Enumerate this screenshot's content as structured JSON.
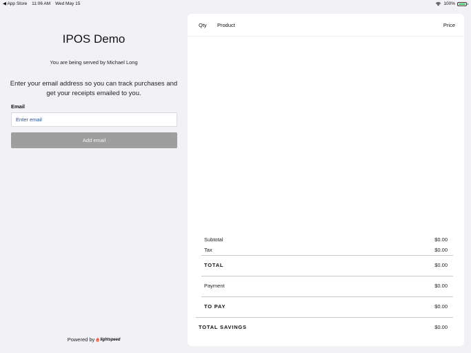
{
  "status_bar": {
    "back_app": "◀ App Store",
    "time": "11:06 AM",
    "date": "Wed May 15",
    "battery": "100%",
    "battery_level": 1.0
  },
  "left": {
    "store_title": "IPOS Demo",
    "served_by": "You are being served by Michael Long",
    "email_prompt": "Enter your email address so you can track purchases and get your receipts emailed to you.",
    "email_label": "Email",
    "email_placeholder": "Enter email",
    "email_value": "",
    "add_email_label": "Add email",
    "powered_by": "Powered by",
    "brand_name": "lightspeed"
  },
  "receipt": {
    "columns": {
      "qty": "Qty",
      "product": "Product",
      "price": "Price"
    },
    "items": [],
    "subtotal": {
      "label": "Subtotal",
      "value": "$0.00"
    },
    "tax": {
      "label": "Tax",
      "value": "$0.00"
    },
    "total": {
      "label": "TOTAL",
      "value": "$0.00"
    },
    "payment": {
      "label": "Payment",
      "value": "$0.00"
    },
    "to_pay": {
      "label": "TO PAY",
      "value": "$0.00"
    },
    "total_savings": {
      "label": "TOTAL SAVINGS",
      "value": "$0.00"
    }
  },
  "colors": {
    "background": "#f2f1f5",
    "panel": "#ffffff",
    "button_disabled": "#9e9e9e",
    "brand_red": "#e8452c",
    "battery_green": "#34c759"
  }
}
